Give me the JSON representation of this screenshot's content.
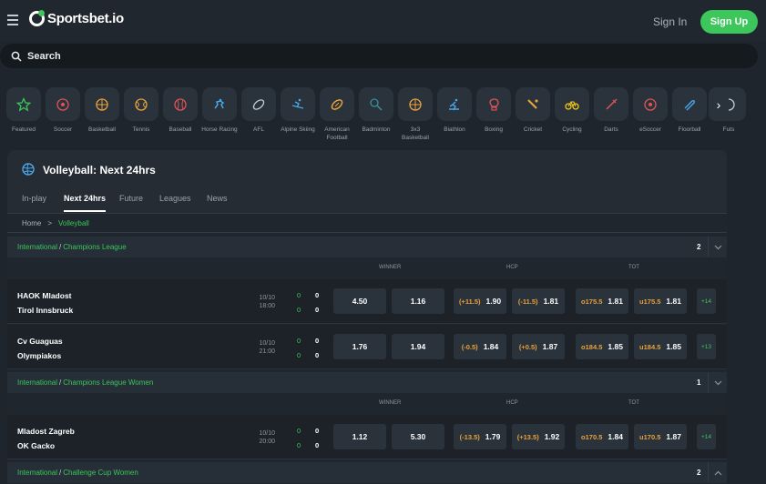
{
  "header": {
    "logo": "Sportsbet.io",
    "signin": "Sign In",
    "signup": "Sign Up"
  },
  "search": {
    "label": "Search"
  },
  "sports": [
    {
      "label": "Featured",
      "icon": "star-icon"
    },
    {
      "label": "Soccer",
      "icon": "soccer-icon"
    },
    {
      "label": "Basketball",
      "icon": "basketball-icon"
    },
    {
      "label": "Tennis",
      "icon": "tennis-icon"
    },
    {
      "label": "Baseball",
      "icon": "baseball-icon"
    },
    {
      "label": "Horse Racing",
      "icon": "horse-racing-icon"
    },
    {
      "label": "AFL",
      "icon": "afl-icon"
    },
    {
      "label": "Alpine Skiing",
      "icon": "skiing-icon"
    },
    {
      "label": "American Football",
      "icon": "american-football-icon"
    },
    {
      "label": "Badminton",
      "icon": "badminton-icon"
    },
    {
      "label": "3x3 Basketball",
      "icon": "basketball-3x3-icon"
    },
    {
      "label": "Biathlon",
      "icon": "biathlon-icon"
    },
    {
      "label": "Boxing",
      "icon": "boxing-icon"
    },
    {
      "label": "Cricket",
      "icon": "cricket-icon"
    },
    {
      "label": "Cycling",
      "icon": "cycling-icon"
    },
    {
      "label": "Darts",
      "icon": "darts-icon"
    },
    {
      "label": "eSoccer",
      "icon": "esoccer-icon"
    },
    {
      "label": "Floorball",
      "icon": "floorball-icon"
    },
    {
      "label": "Futs",
      "icon": "futsal-icon"
    }
  ],
  "panel": {
    "title": "Volleyball: Next 24hrs",
    "tabs": [
      "In-play",
      "Next 24hrs",
      "Future",
      "Leagues",
      "News"
    ],
    "breadcrumb": {
      "home": "Home",
      "sep": ">",
      "current": "Volleyball"
    }
  },
  "markets": {
    "winner": "WINNER",
    "hcp": "HCP",
    "tot": "TOT"
  },
  "leagues": [
    {
      "region": "International",
      "sep": "/",
      "name": "Champions League",
      "count": "2",
      "matches": [
        {
          "home": "HAOK Mladost",
          "away": "Tirol Innsbruck",
          "date": "10/10",
          "time": "18:00",
          "score_home": [
            "0",
            "0"
          ],
          "score_away": [
            "0",
            "0"
          ],
          "w1": "4.50",
          "w2": "1.16",
          "h1_line": "(+11.5)",
          "h1": "1.90",
          "h2_line": "(-11.5)",
          "h2": "1.81",
          "t1_line": "o175.5",
          "t1": "1.81",
          "t2_line": "u175.5",
          "t2": "1.81",
          "more": "+14"
        },
        {
          "home": "Cv Guaguas",
          "away": "Olympiakos",
          "date": "10/10",
          "time": "21:00",
          "score_home": [
            "0",
            "0"
          ],
          "score_away": [
            "0",
            "0"
          ],
          "w1": "1.76",
          "w2": "1.94",
          "h1_line": "(-0.5)",
          "h1": "1.84",
          "h2_line": "(+0.5)",
          "h2": "1.87",
          "t1_line": "o184.5",
          "t1": "1.85",
          "t2_line": "u184.5",
          "t2": "1.85",
          "more": "+13"
        }
      ]
    },
    {
      "region": "International",
      "sep": "/",
      "name": "Champions League Women",
      "count": "1",
      "matches": [
        {
          "home": "Mladost Zagreb",
          "away": "OK Gacko",
          "date": "10/10",
          "time": "20:00",
          "score_home": [
            "0",
            "0"
          ],
          "score_away": [
            "0",
            "0"
          ],
          "w1": "1.12",
          "w2": "5.30",
          "h1_line": "(-13.5)",
          "h1": "1.79",
          "h2_line": "(+13.5)",
          "h2": "1.92",
          "t1_line": "o170.5",
          "t1": "1.84",
          "t2_line": "u170.5",
          "t2": "1.87",
          "more": "+14"
        }
      ]
    },
    {
      "region": "International",
      "sep": "/",
      "name": "Challenge Cup Women",
      "count": "2",
      "matches": []
    }
  ],
  "colors": {
    "accent": "#3cc65b",
    "handicap": "#e9a23b",
    "bg": "#1f252c"
  }
}
